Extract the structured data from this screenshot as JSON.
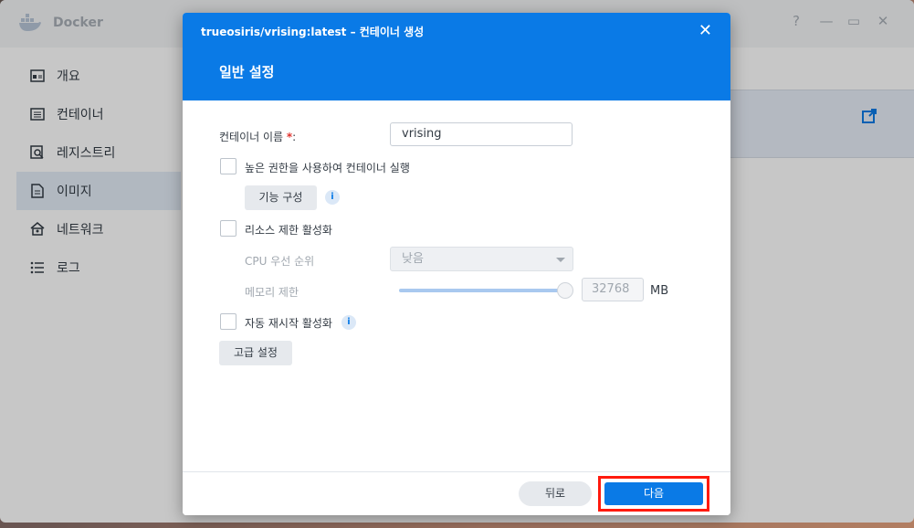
{
  "app": {
    "title": "Docker",
    "controls": [
      "?",
      "—",
      "▭",
      "✕"
    ]
  },
  "sidebar": {
    "items": [
      {
        "label": "개요",
        "icon": "overview-icon"
      },
      {
        "label": "컨테이너",
        "icon": "container-icon"
      },
      {
        "label": "레지스트리",
        "icon": "registry-icon"
      },
      {
        "label": "이미지",
        "icon": "image-icon",
        "active": true
      },
      {
        "label": "네트워크",
        "icon": "network-icon"
      },
      {
        "label": "로그",
        "icon": "log-icon"
      }
    ]
  },
  "modal": {
    "title": "trueosiris/vrising:latest – 컨테이너 생성",
    "close": "✕",
    "subtitle": "일반 설정",
    "container_name_label": "컨테이너 이름",
    "required_mark": "*",
    "colon": ":",
    "container_name_value": "vrising",
    "privileged_label": "높은 권한을 사용하여 컨테이너 실행",
    "capabilities_button": "기능 구성",
    "resource_limit_label": "리소스 제한 활성화",
    "cpu_priority_label": "CPU 우선 순위",
    "cpu_priority_value": "낮음",
    "memory_limit_label": "메모리 제한",
    "memory_value": "32768",
    "memory_unit": "MB",
    "memory_slider_fraction": 1.0,
    "auto_restart_label": "자동 재시작 활성화",
    "advanced_button": "고급 설정",
    "info_glyph": "i",
    "back_button": "뒤로",
    "next_button": "다음"
  },
  "colors": {
    "accent": "#0a7ae6",
    "highlight_border": "#ff1a0e"
  }
}
